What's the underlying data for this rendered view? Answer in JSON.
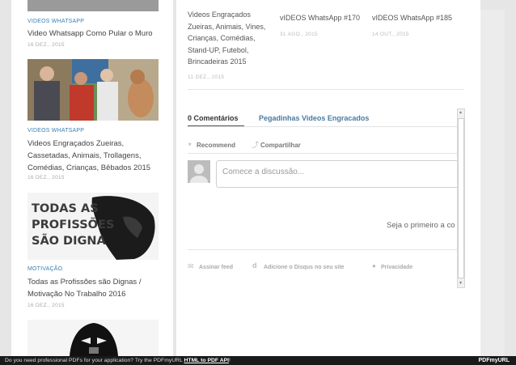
{
  "sidebar": {
    "posts": [
      {
        "category": "VIDEOS WHATSAPP",
        "title": "Video Whatsapp Como Pular o Muro",
        "date": "16 DEZ., 2015"
      },
      {
        "category": "VIDEOS WHATSAPP",
        "title": "Videos Engraçados Zueiras, Cassetadas, Animais, Trollagens, Comédias, Crianças, Bêbados 2015",
        "date": "16 DEZ., 2015"
      },
      {
        "category": "MOTIVAÇÃO",
        "title": "Todas as Profissões são Dignas / Motivação No Trabalho 2016",
        "date": "16 DEZ., 2015",
        "image_text": "TODAS AS PROFISSÕES SÃO DIGNA"
      }
    ]
  },
  "related": [
    {
      "title": "Videos Engraçados Zueiras, Animais, Vines, Crianças, Comédias, Stand-UP, Futebol, Brincadeiras 2015",
      "date": "11 DEZ., 2015"
    },
    {
      "title": "vIDEOS WhatsApp #170",
      "date": "31 AGO., 2015"
    },
    {
      "title": "vIDEOS WhatsApp #185",
      "date": "14 OUT., 2015"
    }
  ],
  "disqus": {
    "tab_comments": "0 Comentários",
    "tab_site": "Pegadinhas Videos Engracados",
    "recommend": "Recommend",
    "share": "Compartilhar",
    "input_placeholder": "Comece a discussão...",
    "first_text": "Seja o primeiro a co",
    "subscribe": "Assinar feed",
    "add_disqus": "Adicione o Disqus no seu site",
    "privacy": "Privacidade"
  },
  "bottom_bar": {
    "text": "Do you need professional PDFs for your application? Try the PDFmyURL",
    "link": "HTML to PDF API",
    "end": "!",
    "logo": "PDFmyURL"
  }
}
